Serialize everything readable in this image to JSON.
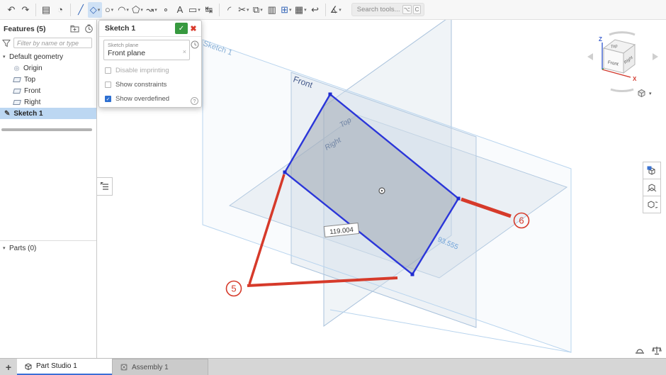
{
  "toolbar": {
    "caret": "▾",
    "search": {
      "placeholder": "Search tools...",
      "key1": "⌥",
      "key2": "C"
    },
    "tools": [
      {
        "name": "undo",
        "icon": "↶"
      },
      {
        "name": "redo",
        "icon": "↷"
      },
      {
        "name": "sheet-metal",
        "icon": "▤"
      },
      {
        "name": "helix",
        "icon": "◔"
      },
      {
        "name": "line",
        "icon": "╱"
      },
      {
        "name": "rectangle",
        "icon": "◇"
      },
      {
        "name": "circle",
        "icon": "○"
      },
      {
        "name": "arc",
        "icon": "◠"
      },
      {
        "name": "polygon",
        "icon": "⬠"
      },
      {
        "name": "spline",
        "icon": "↝"
      },
      {
        "name": "point",
        "icon": "∘"
      },
      {
        "name": "text",
        "icon": "A"
      },
      {
        "name": "construction",
        "icon": "▭"
      },
      {
        "name": "dimension",
        "icon": "↹"
      },
      {
        "name": "fillet",
        "icon": "◜"
      },
      {
        "name": "trim",
        "icon": "✂"
      },
      {
        "name": "offset",
        "icon": "⧉"
      },
      {
        "name": "linear-pattern",
        "icon": "▥"
      },
      {
        "name": "circular-pattern",
        "icon": "⊞"
      },
      {
        "name": "insert-image",
        "icon": "▦"
      },
      {
        "name": "project",
        "icon": "↩"
      },
      {
        "name": "measure",
        "icon": "∡"
      }
    ]
  },
  "features_panel": {
    "title": "Features (5)",
    "filter_placeholder": "Filter by name or type",
    "group_label": "Default geometry",
    "chevron": "▾",
    "origin_icon": "◎",
    "items": [
      {
        "label": "Origin"
      },
      {
        "label": "Top"
      },
      {
        "label": "Front"
      },
      {
        "label": "Right"
      }
    ],
    "sketch_item": "Sketch 1",
    "pencil_icon": "✎",
    "parts_header": "Parts (0)"
  },
  "dialog": {
    "title": "Sketch 1",
    "confirm_glyph": "✓",
    "close_glyph": "✖",
    "field_label": "Sketch plane",
    "field_value": "Front plane",
    "clear_glyph": "×",
    "check_glyph": "✓",
    "help_glyph": "?",
    "checkboxes": [
      {
        "label": "Disable imprinting",
        "checked": false,
        "disabled": true
      },
      {
        "label": "Show constraints",
        "checked": false,
        "disabled": false
      },
      {
        "label": "Show overdefined",
        "checked": true,
        "disabled": false
      }
    ]
  },
  "viewport": {
    "plane_labels": {
      "sketch": "Sketch 1",
      "front": "Front",
      "top": "Top",
      "right": "Right"
    },
    "dimensions": {
      "width": "119.004",
      "height": "93.555"
    },
    "annotations": {
      "a5": "5",
      "a6": "6"
    }
  },
  "view_cube": {
    "top": "Top",
    "front": "Front",
    "right": "Right",
    "z": "Z",
    "x": "X"
  },
  "tabs": {
    "add_glyph": "+",
    "items": [
      {
        "label": "Part Studio 1",
        "active": true
      },
      {
        "label": "Assembly 1",
        "active": false
      }
    ]
  },
  "colors": {
    "accent": "#2d6fd1",
    "selection": "#bcd7f2",
    "sketch_blue": "#2b36d9",
    "annotation_red": "#d63a2a",
    "dimension_blue": "#6ea2d9",
    "plane_label": "#5c77a6"
  }
}
